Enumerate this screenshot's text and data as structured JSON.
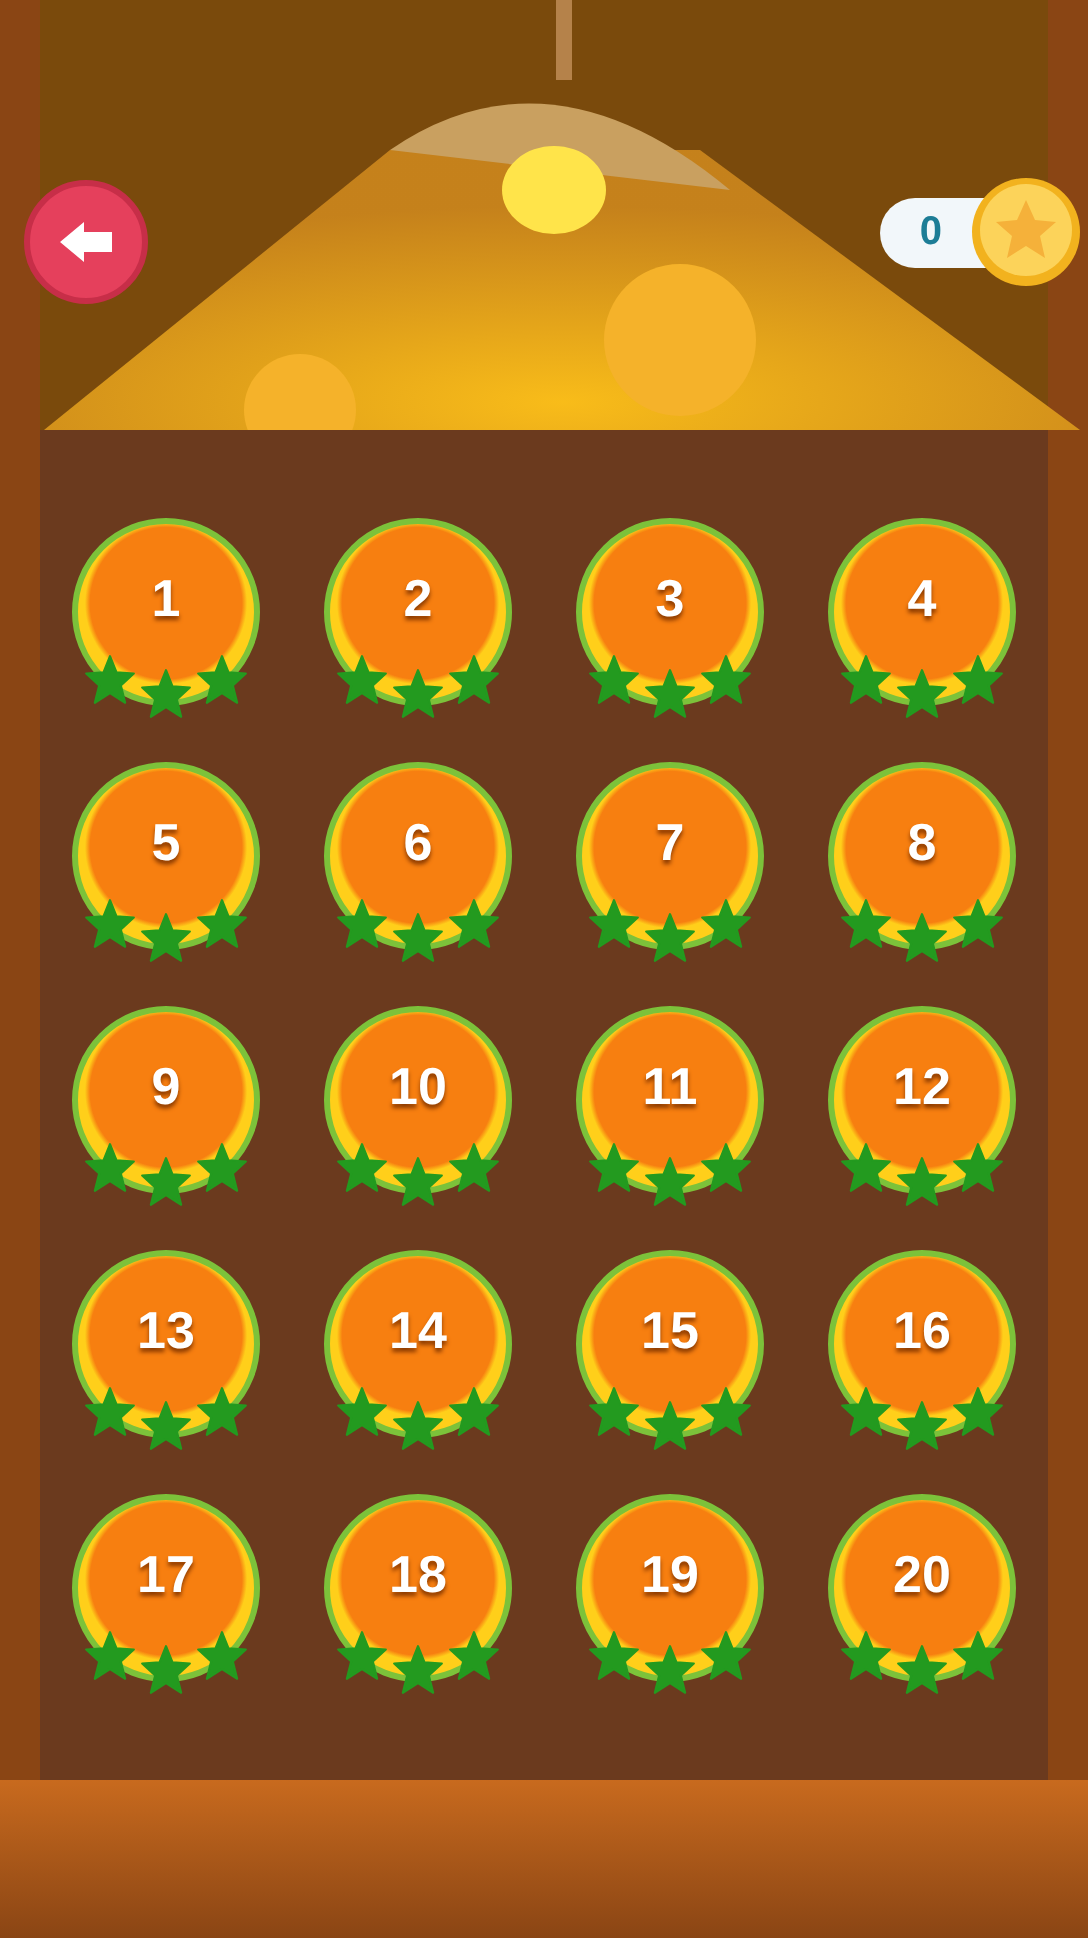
{
  "coins": {
    "count": "0"
  },
  "levels": [
    {
      "number": "1",
      "stars": 3
    },
    {
      "number": "2",
      "stars": 3
    },
    {
      "number": "3",
      "stars": 3
    },
    {
      "number": "4",
      "stars": 3
    },
    {
      "number": "5",
      "stars": 3
    },
    {
      "number": "6",
      "stars": 3
    },
    {
      "number": "7",
      "stars": 3
    },
    {
      "number": "8",
      "stars": 3
    },
    {
      "number": "9",
      "stars": 3
    },
    {
      "number": "10",
      "stars": 3
    },
    {
      "number": "11",
      "stars": 3
    },
    {
      "number": "12",
      "stars": 3
    },
    {
      "number": "13",
      "stars": 3
    },
    {
      "number": "14",
      "stars": 3
    },
    {
      "number": "15",
      "stars": 3
    },
    {
      "number": "16",
      "stars": 3
    },
    {
      "number": "17",
      "stars": 3
    },
    {
      "number": "18",
      "stars": 3
    },
    {
      "number": "19",
      "stars": 3
    },
    {
      "number": "20",
      "stars": 3
    }
  ]
}
